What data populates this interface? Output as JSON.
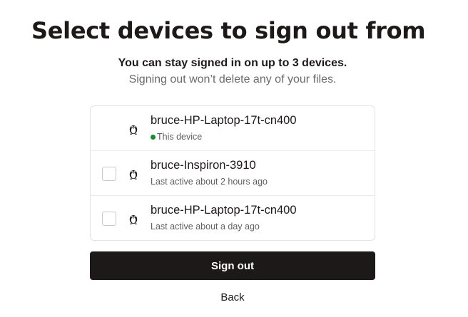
{
  "header": {
    "title": "Select devices to sign out from",
    "subtitle": "You can stay signed in on up to 3 devices.",
    "note": "Signing out won’t delete any of your files."
  },
  "devices": [
    {
      "name": "bruce-HP-Laptop-17t-cn400",
      "status": "This device",
      "icon": "linux-penguin-icon",
      "current": true,
      "status_dot_color": "#1a8a2e"
    },
    {
      "name": "bruce-Inspiron-3910",
      "status": "Last active about 2 hours ago",
      "icon": "linux-penguin-icon",
      "checked": false
    },
    {
      "name": "bruce-HP-Laptop-17t-cn400",
      "status": "Last active about a day ago",
      "icon": "linux-penguin-icon",
      "checked": false
    }
  ],
  "actions": {
    "sign_out_label": "Sign out",
    "back_label": "Back"
  },
  "colors": {
    "primary": "#1e1919",
    "muted_text": "#6b6b6b",
    "online": "#1a8a2e"
  }
}
